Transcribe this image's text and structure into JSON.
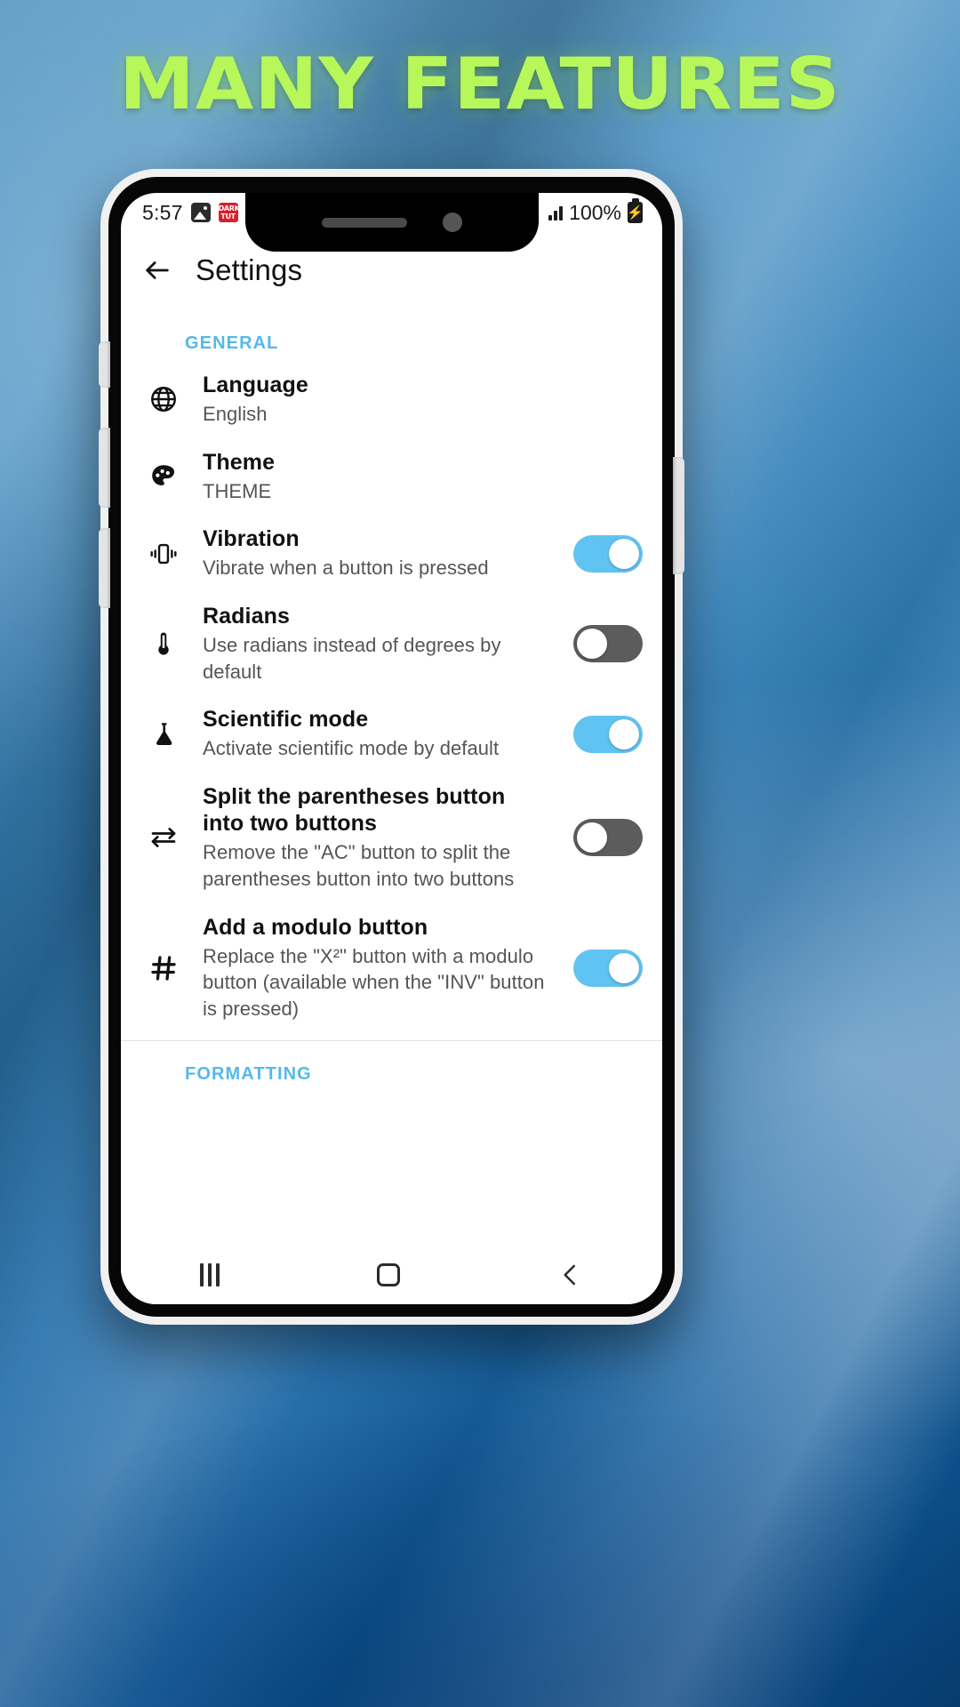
{
  "promo": {
    "headline": "MANY FEATURES",
    "headline_color": "#b7f75a"
  },
  "phone": {
    "statusbar": {
      "time": "5:57",
      "icons": [
        "photo-icon",
        "app-badge-icon",
        "signal-icon"
      ],
      "app_badge_text": "DARK TUT",
      "battery_percent": "100%",
      "battery_icon": "battery-charging-icon"
    },
    "appbar": {
      "back_icon": "back-arrow-icon",
      "title": "Settings"
    },
    "navbar": {
      "recent_icon": "recent-apps-icon",
      "home_icon": "home-icon",
      "back_icon": "nav-back-icon"
    }
  },
  "settings": {
    "accent_color": "#55b9e8",
    "toggle_on_color": "#61c3f2",
    "toggle_off_color": "#5c5c5c",
    "sections": [
      {
        "header": "GENERAL",
        "items": [
          {
            "icon": "globe-icon",
            "title": "Language",
            "subtitle": "English",
            "control": "none"
          },
          {
            "icon": "palette-icon",
            "title": "Theme",
            "subtitle": "THEME",
            "control": "none"
          },
          {
            "icon": "vibration-icon",
            "title": "Vibration",
            "subtitle": "Vibrate when a button is pressed",
            "control": "toggle",
            "state": "on"
          },
          {
            "icon": "thermometer-icon",
            "title": "Radians",
            "subtitle": "Use radians instead of degrees by default",
            "control": "toggle",
            "state": "off"
          },
          {
            "icon": "flask-icon",
            "title": "Scientific mode",
            "subtitle": "Activate scientific mode by default",
            "control": "toggle",
            "state": "on"
          },
          {
            "icon": "swap-arrows-icon",
            "title": "Split the parentheses button into two buttons",
            "subtitle": "Remove the \"AC\" button to split the parentheses button into two buttons",
            "control": "toggle",
            "state": "off"
          },
          {
            "icon": "hash-icon",
            "title": "Add a modulo button",
            "subtitle": "Replace the \"X²\" button with a modulo button (available when the \"INV\" button is pressed)",
            "control": "toggle",
            "state": "on"
          }
        ]
      },
      {
        "header": "FORMATTING",
        "items": []
      }
    ]
  }
}
